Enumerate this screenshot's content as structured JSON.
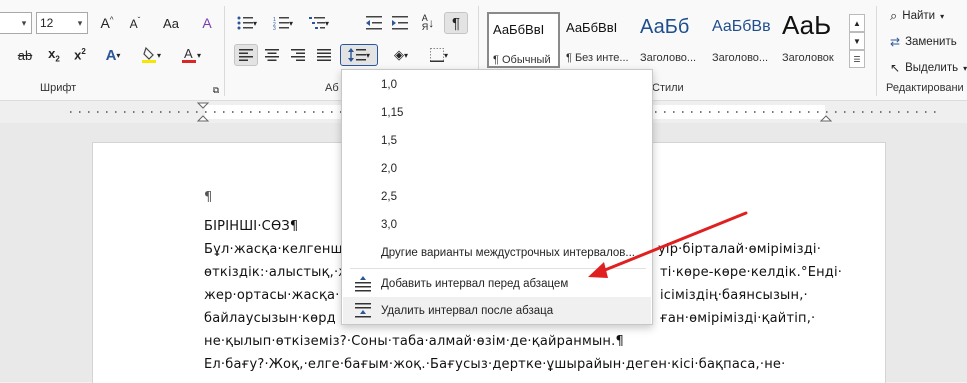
{
  "ribbon": {
    "font_name": "",
    "font_size": "12",
    "font_group_label": "Шрифт",
    "paragraph_group_label": "Аб",
    "styles_group_label": "Стили",
    "editing_group_label": "Редактировани",
    "styles": [
      {
        "sample": "АаБбВвІ",
        "name": "¶ Обычный"
      },
      {
        "sample": "АаБбВвІ",
        "name": "¶ Без инте..."
      },
      {
        "sample": "АаБб",
        "name": "Заголово..."
      },
      {
        "sample": "АаБбВв",
        "name": "Заголово..."
      },
      {
        "sample": "АаЬ",
        "name": "Заголовок"
      }
    ],
    "find_label": "Найти",
    "replace_label": "Заменить",
    "select_label": "Выделить",
    "colors": {
      "highlight": "#f6e600",
      "font_color": "#d92626",
      "accent": "#2b579a"
    }
  },
  "line_spacing_menu": {
    "options": [
      "1,0",
      "1,15",
      "1,5",
      "2,0",
      "2,5",
      "3,0"
    ],
    "more_options": "Другие варианты междустрочных интервалов...",
    "add_before": "Добавить интервал перед абзацем",
    "remove_after": "Удалить интервал после абзаца"
  },
  "document": {
    "lines": [
      "¶",
      "БІРІНШІ·СӨЗ¶",
      "Бұл·жасқа·келгенш",
      "өткіздік:·алыстық,·ж",
      "жер·ортасы·жасқа·",
      "байлаусызын·көрд",
      "не·қылып·өткіземіз?·Соны·таба·алмай·өзім·де·қайранмын.¶",
      "Ел·бағу?·Жоқ,·елге·бағым·жоқ.·Бағусыз·дертке·ұшырайын·деген·кісі·бақпаса,·не·"
    ],
    "right_fragments": [
      "уір·біртaлай·өмірімізді·",
      "ті·көре-көре·келдік.°Енді·",
      "ісіміздің·баянсызын,·",
      "ған·өмірімізді·қайтіп,·"
    ]
  }
}
